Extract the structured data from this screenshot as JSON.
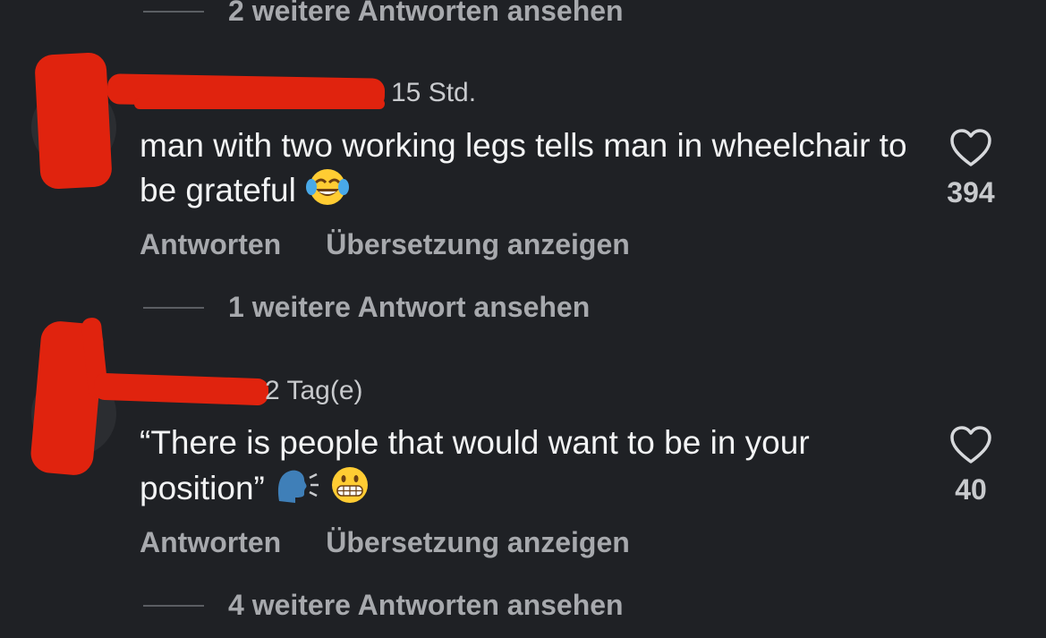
{
  "top_replies_label": "2 weitere Antworten ansehen",
  "comments": [
    {
      "timestamp": "15 Std.",
      "text": "man with two working legs tells man in wheelchair to be grateful",
      "emoji": "face-with-tears-of-joy",
      "like_count": "394",
      "reply_label": "Antworten",
      "translate_label": "Übersetzung anzeigen",
      "more_replies_label": "1 weitere Antwort ansehen"
    },
    {
      "timestamp": "2 Tag(e)",
      "text": "“There is people that would want to be in your position”",
      "emoji": "speaking-head-and-grimacing-face",
      "like_count": "40",
      "reply_label": "Antworten",
      "translate_label": "Übersetzung anzeigen",
      "more_replies_label": "4 weitere Antworten ansehen"
    }
  ],
  "colors": {
    "background": "#1f2125",
    "primary_text": "#f2f3f4",
    "secondary_text": "#a7a9ad",
    "redaction": "#e0230e"
  }
}
